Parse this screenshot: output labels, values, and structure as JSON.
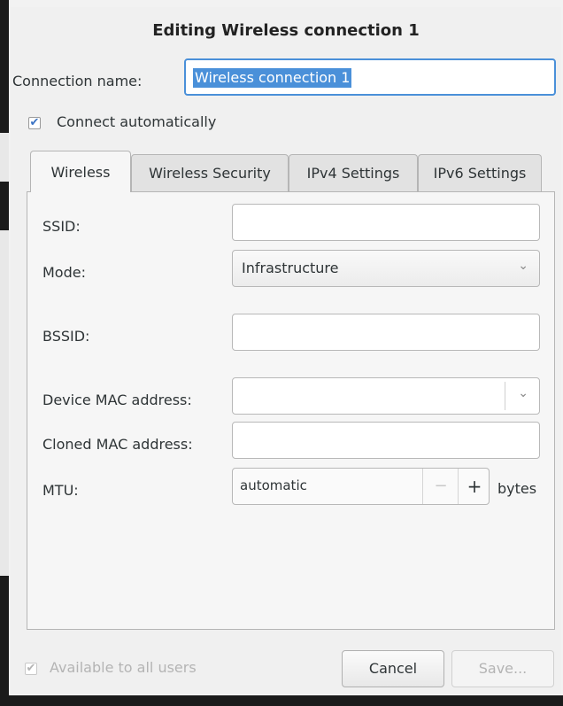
{
  "dialog": {
    "title": "Editing Wireless connection 1",
    "connection_name_label": "Connection name:",
    "connection_name_value": "Wireless connection 1",
    "connect_automatically_label": "Connect automatically",
    "connect_automatically_checked": true
  },
  "tabs": [
    {
      "label": "Wireless",
      "active": true
    },
    {
      "label": "Wireless Security",
      "active": false
    },
    {
      "label": "IPv4 Settings",
      "active": false
    },
    {
      "label": "IPv6 Settings",
      "active": false
    }
  ],
  "wireless": {
    "ssid_label": "SSID:",
    "ssid_value": "",
    "mode_label": "Mode:",
    "mode_value": "Infrastructure",
    "bssid_label": "BSSID:",
    "bssid_value": "",
    "device_mac_label": "Device MAC address:",
    "device_mac_value": "",
    "cloned_mac_label": "Cloned MAC address:",
    "cloned_mac_value": "",
    "mtu_label": "MTU:",
    "mtu_value": "automatic",
    "mtu_minus": "−",
    "mtu_plus": "+",
    "mtu_unit": "bytes"
  },
  "footer": {
    "available_to_all_users_label": "Available to all users",
    "available_to_all_users_checked": true,
    "cancel_label": "Cancel",
    "save_label": "Save..."
  },
  "icons": {
    "check": "✔",
    "chevron": "⌄"
  },
  "colors": {
    "accent": "#4a90d9",
    "check_color": "#3b73c4",
    "disabled_text": "#b4b4b4"
  }
}
